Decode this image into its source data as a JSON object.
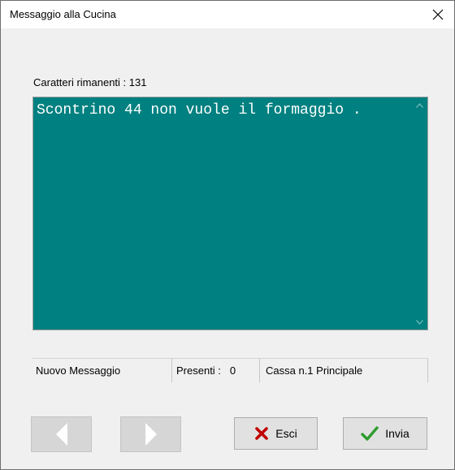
{
  "window": {
    "title": "Messaggio alla Cucina",
    "close_glyph": "✕"
  },
  "message": {
    "remaining_label": "Caratteri rimanenti :",
    "remaining_count": "131",
    "text": "Scontrino 44 non vuole il formaggio .",
    "box_color": "#008080",
    "text_color": "#ffffff"
  },
  "status": {
    "new_message": "Nuovo Messaggio",
    "present_label": "Presenti :",
    "present_count": "0",
    "register": "Cassa n.1 Principale"
  },
  "buttons": {
    "prev_icon": "triangle-left-icon",
    "next_icon": "triangle-right-icon",
    "exit_label": "Esci",
    "exit_icon": "red-x-icon",
    "exit_icon_color": "#c00000",
    "send_label": "Invia",
    "send_icon": "green-check-icon",
    "send_icon_color": "#2e9b2e"
  }
}
